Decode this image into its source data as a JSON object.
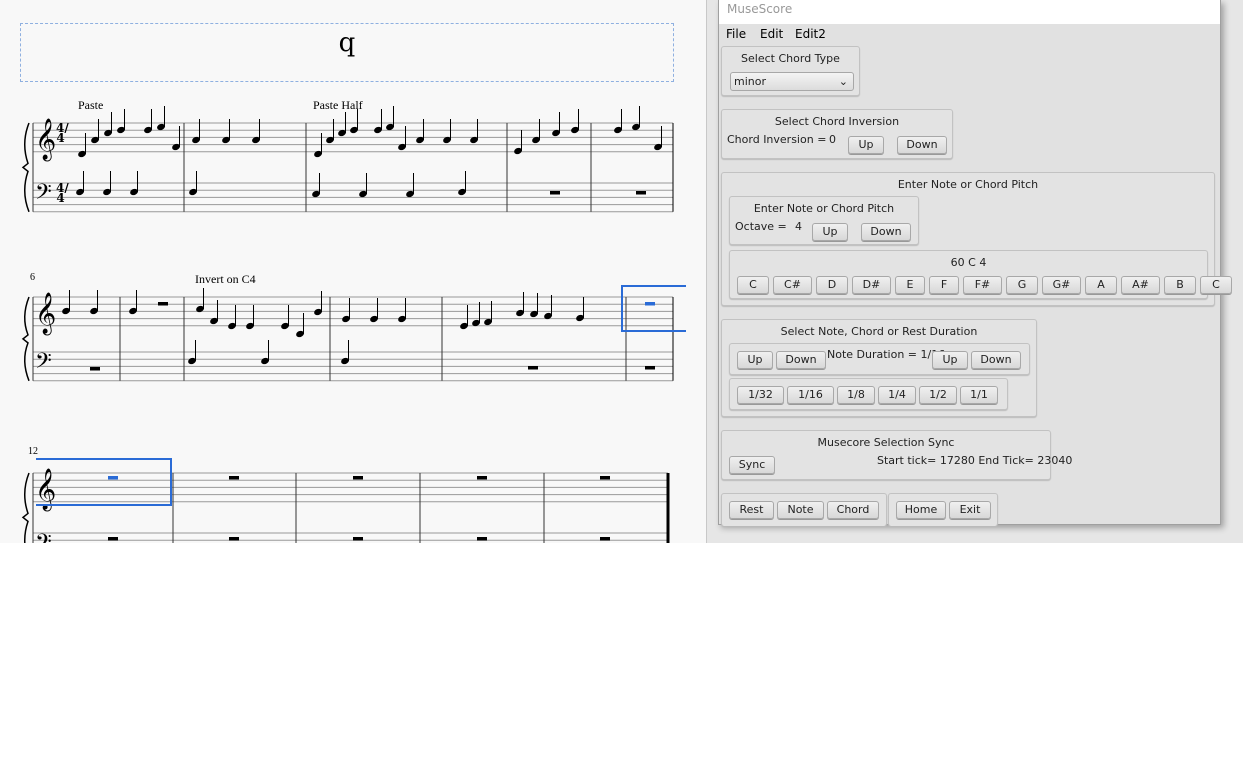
{
  "score": {
    "title": "q",
    "staff_texts": [
      "Paste",
      "Paste Half",
      "Invert on C4"
    ],
    "measure_numbers": [
      "6",
      "12"
    ],
    "time_signature": "4/4",
    "selection_color": "#2a6bd6"
  },
  "window": {
    "title": "MuseScore",
    "menu": [
      "File",
      "Edit",
      "Edit2"
    ],
    "chord_type": {
      "title": "Select Chord Type",
      "selected": "minor"
    },
    "inversion": {
      "title": "Select Chord Inversion",
      "label": "Chord Inversion =",
      "value": "0",
      "up": "Up",
      "down": "Down"
    },
    "pitch": {
      "title": "Enter Note or Chord Pitch",
      "sub_title": "Enter Note or Chord Pitch",
      "octave_label": "Octave =",
      "octave_value": "4",
      "up": "Up",
      "down": "Down",
      "current": "60 C 4",
      "notes": [
        "C",
        "C#",
        "D",
        "D#",
        "E",
        "F",
        "F#",
        "G",
        "G#",
        "A",
        "A#",
        "B",
        "C"
      ]
    },
    "duration": {
      "title": "Select Note, Chord or Rest Duration",
      "up1": "Up",
      "down1": "Down",
      "label": "Note Duration = 1/16",
      "up2": "Up",
      "down2": "Down",
      "values": [
        "1/32",
        "1/16",
        "1/8",
        "1/4",
        "1/2",
        "1/1"
      ]
    },
    "sync": {
      "title": "Musecore Selection Sync",
      "button": "Sync",
      "status": "Start tick= 17280 End Tick= 23040"
    },
    "bottom": {
      "rest": "Rest",
      "note": "Note",
      "chord": "Chord",
      "home": "Home",
      "exit": "Exit"
    }
  }
}
